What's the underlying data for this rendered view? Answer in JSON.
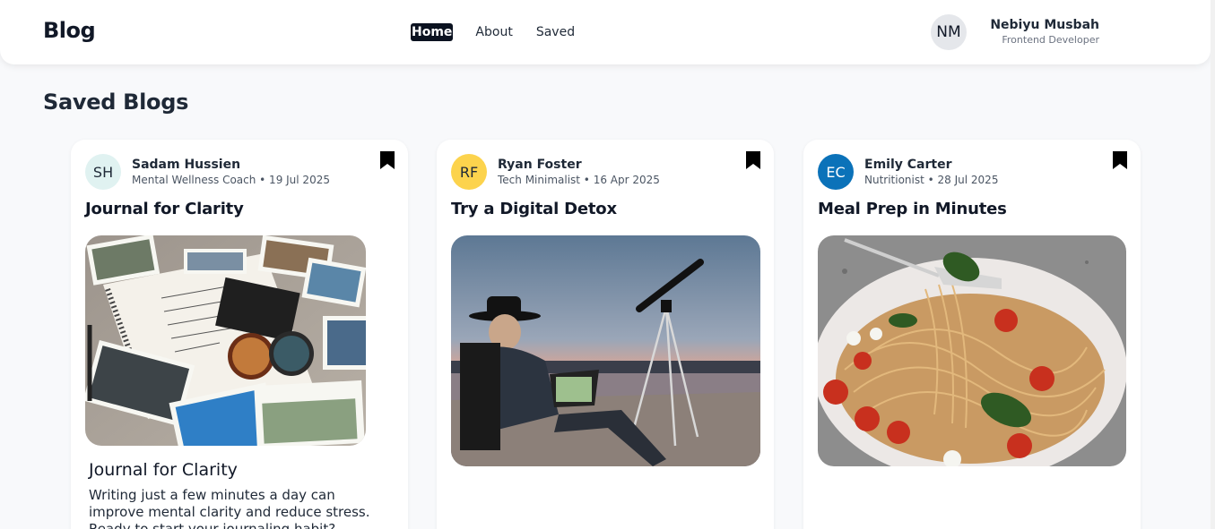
{
  "header": {
    "brand": "Blog",
    "nav": [
      "Home",
      "About",
      "Saved"
    ],
    "active_nav": "Home",
    "user": {
      "initials": "NM",
      "name": "Nebiyu Musbah",
      "role": "Frontend Developer"
    }
  },
  "page": {
    "title": "Saved Blogs"
  },
  "cards": [
    {
      "initials": "SH",
      "avatar_bg": "#e0f2f1",
      "avatar_fg": "#1f2937",
      "author": "Sadam Hussien",
      "meta": "Mental Wellness Coach • 19 Jul 2025",
      "title": "Journal for Clarity",
      "image": "journal-photo",
      "subtitle": "Journal for Clarity",
      "excerpt": "Writing just a few minutes a day can improve mental clarity and reduce stress. Ready to start your journaling habit?"
    },
    {
      "initials": "RF",
      "avatar_bg": "#fcd34d",
      "avatar_fg": "#1f2937",
      "author": "Ryan Foster",
      "meta": "Tech Minimalist • 16 Apr 2025",
      "title": "Try a Digital Detox",
      "image": "telescope-laptop-photo"
    },
    {
      "initials": "EC",
      "avatar_bg": "#0b72b9",
      "avatar_fg": "#ffffff",
      "author": "Emily Carter",
      "meta": "Nutritionist • 28 Jul 2025",
      "title": "Meal Prep in Minutes",
      "image": "pasta-photo"
    }
  ]
}
